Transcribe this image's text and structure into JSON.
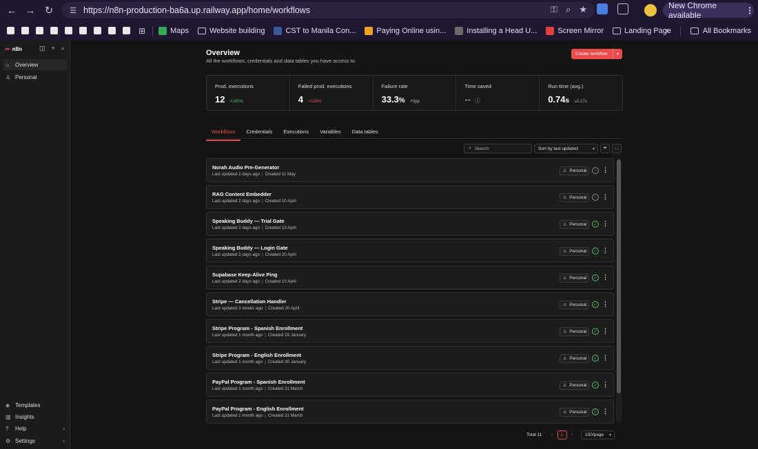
{
  "browser": {
    "url": "https://n8n-production-ba6a.up.railway.app/home/workflows",
    "new_chrome_label": "New Chrome available",
    "bookmarks": [
      {
        "label": "Maps",
        "icon": "maps-icon"
      },
      {
        "label": "Website building",
        "icon": "folder-icon"
      },
      {
        "label": "CST to Manila Con...",
        "icon": "clock-icon"
      },
      {
        "label": "Paying Online usin...",
        "icon": "flame-icon"
      },
      {
        "label": "Installing a Head U...",
        "icon": "site-icon"
      },
      {
        "label": "Screen Mirror",
        "icon": "mirror-icon"
      },
      {
        "label": "Landing Page",
        "icon": "folder-icon"
      }
    ],
    "all_bookmarks_label": "All Bookmarks"
  },
  "sidebar": {
    "logo_text": "n8n",
    "top_items": [
      {
        "label": "Overview",
        "icon": "home-icon"
      },
      {
        "label": "Personal",
        "icon": "user-icon"
      }
    ],
    "bottom_items": [
      {
        "label": "Templates",
        "icon": "box-icon"
      },
      {
        "label": "Insights",
        "icon": "chart-icon"
      },
      {
        "label": "Help",
        "icon": "help-icon"
      },
      {
        "label": "Settings",
        "icon": "gear-icon"
      }
    ]
  },
  "header": {
    "title": "Overview",
    "subtitle": "All the workflows, credentials and data tables you have access to",
    "create_label": "Create workflow"
  },
  "stats": [
    {
      "label": "Prod. executions",
      "value": "12",
      "unit": "",
      "delta": "↗100%",
      "tone": "up"
    },
    {
      "label": "Failed prod. executions",
      "value": "4",
      "unit": "",
      "delta": "↗100%",
      "tone": "bad"
    },
    {
      "label": "Failure rate",
      "value": "33.3",
      "unit": "%",
      "delta": "↗0pp",
      "tone": "neutral"
    },
    {
      "label": "Time saved",
      "value": "--",
      "unit": "",
      "delta": "ⓘ",
      "tone": "neutral"
    },
    {
      "label": "Run time (avg.)",
      "value": "0.74",
      "unit": "s",
      "delta": "↘0.17s",
      "tone": "neutral"
    }
  ],
  "tabs": [
    "Workflows",
    "Credentials",
    "Executions",
    "Variables",
    "Data tables"
  ],
  "toolbar": {
    "search_placeholder": "Search",
    "sort_label": "Sort by last updated"
  },
  "workflows": [
    {
      "name": "Norah Audio Pre-Generator",
      "updated": "Last updated 2 days ago",
      "created": "Created 11 May",
      "owner": "Personal",
      "active": false
    },
    {
      "name": "RAG Content Embedder",
      "updated": "Last updated 2 days ago",
      "created": "Created 10 April",
      "owner": "Personal",
      "active": false
    },
    {
      "name": "Speaking Buddy — Trial Gate",
      "updated": "Last updated 2 days ago",
      "created": "Created 13 April",
      "owner": "Personal",
      "active": true
    },
    {
      "name": "Speaking Buddy — Login Gate",
      "updated": "Last updated 2 days ago",
      "created": "Created 20 April",
      "owner": "Personal",
      "active": true
    },
    {
      "name": "Supabase Keep-Alive Ping",
      "updated": "Last updated 2 days ago",
      "created": "Created 10 April",
      "owner": "Personal",
      "active": true
    },
    {
      "name": "Stripe — Cancellation Handler",
      "updated": "Last updated 3 weeks ago",
      "created": "Created 20 April",
      "owner": "Personal",
      "active": true
    },
    {
      "name": "Stripe Program - Spanish Enrollment",
      "updated": "Last updated 1 month ago",
      "created": "Created 29 January",
      "owner": "Personal",
      "active": true
    },
    {
      "name": "Stripe Program - English Enrollment",
      "updated": "Last updated 1 month ago",
      "created": "Created 30 January",
      "owner": "Personal",
      "active": true
    },
    {
      "name": "PayPal Program - Spanish Enrollment",
      "updated": "Last updated 1 month ago",
      "created": "Created 31 March",
      "owner": "Personal",
      "active": true
    },
    {
      "name": "PayPal Program - English Enrollment",
      "updated": "Last updated 1 month ago",
      "created": "Created 31 March",
      "owner": "Personal",
      "active": true
    }
  ],
  "pagination": {
    "total_label": "Total 11",
    "current_page": "1",
    "per_page": "100/page"
  },
  "colors": {
    "accent": "#ea4b4b",
    "success": "#4fc36b",
    "chrome_bg": "#1f1630"
  }
}
